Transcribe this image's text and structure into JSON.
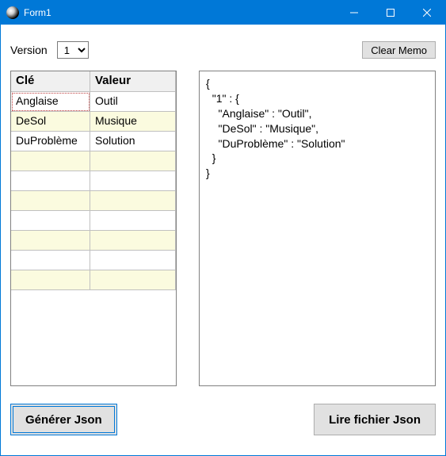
{
  "window": {
    "title": "Form1"
  },
  "top": {
    "version_label": "Version",
    "version_value": "1",
    "clear_memo_label": "Clear Memo"
  },
  "grid": {
    "headers": {
      "key": "Clé",
      "value": "Valeur"
    },
    "rows": [
      {
        "key": "Anglaise",
        "value": "Outil"
      },
      {
        "key": "DeSol",
        "value": "Musique"
      },
      {
        "key": "DuProblème",
        "value": "Solution"
      },
      {
        "key": "",
        "value": ""
      },
      {
        "key": "",
        "value": ""
      },
      {
        "key": "",
        "value": ""
      },
      {
        "key": "",
        "value": ""
      },
      {
        "key": "",
        "value": ""
      },
      {
        "key": "",
        "value": ""
      },
      {
        "key": "",
        "value": ""
      }
    ],
    "selected_index": 0
  },
  "memo": {
    "text": "{\n  \"1\" : {\n    \"Anglaise\" : \"Outil\",\n    \"DeSol\" : \"Musique\",\n    \"DuProblème\" : \"Solution\"\n  }\n}"
  },
  "bottom": {
    "generate_label": "Générer Json",
    "read_label": "Lire fichier Json"
  }
}
